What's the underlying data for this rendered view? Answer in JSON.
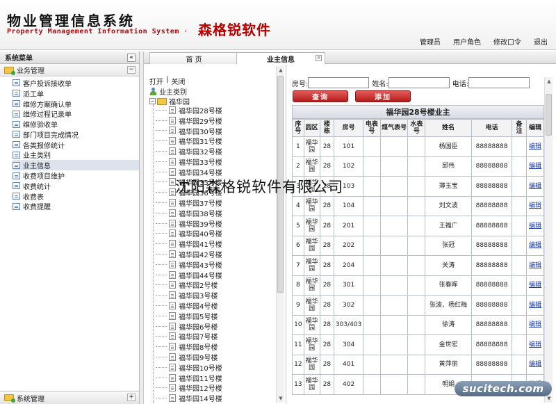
{
  "header": {
    "title_cn": "物业管理信息系统",
    "title_en": "Property  Management Information System ·",
    "company": "森格锐软件",
    "nav": [
      "管理员",
      "用户角色",
      "修改口令",
      "退出"
    ]
  },
  "sidebar": {
    "title": "系统菜单",
    "collapse": "«",
    "group": "业务管理",
    "group_toggle": "−",
    "items": [
      "客户投诉接收单",
      "派工单",
      "维修方案确认单",
      "维修过程记录单",
      "维修验收单",
      "部门项目完成情况",
      "各类报修统计",
      "业主类别",
      "业主信息",
      "收费项目维护",
      "收费统计",
      "收费表",
      "收费提醒"
    ],
    "active_item": "业主信息",
    "bottom_group": "系统管理",
    "bottom_toggle": "+"
  },
  "tabs": {
    "home": "首  页",
    "owner": "业主信息",
    "close": "×"
  },
  "tree": {
    "open": "打开",
    "sep": "|",
    "close": "关闭",
    "root": "业主类别",
    "park": "福华园",
    "expander": "−",
    "buildings": [
      "福华园28号楼",
      "福华园29号楼",
      "福华园30号楼",
      "福华园31号楼",
      "福华园32号楼",
      "福华园33号楼",
      "福华园34号楼",
      "福华园35号楼",
      "福华园36号楼",
      "福华园37号楼",
      "福华园38号楼",
      "福华园39号楼",
      "福华园40号楼",
      "福华园41号楼",
      "福华园42号楼",
      "福华园43号楼",
      "福华园44号楼",
      "福华园2号楼",
      "福华园3号楼",
      "福华园4号楼",
      "福华园5号楼",
      "福华园6号楼",
      "福华园7号楼",
      "福华园8号楼",
      "福华园9号楼",
      "福华园10号楼",
      "福华园11号楼",
      "福华园12号楼",
      "福华园14号楼"
    ]
  },
  "search": {
    "room_label": "房号:",
    "name_label": "姓名:",
    "phone_label": "电话:",
    "query_btn": "查询",
    "add_btn": "添加"
  },
  "grid": {
    "title": "福华园28号楼业主",
    "headers": [
      "序号",
      "园区",
      "楼栋",
      "房号",
      "电表号",
      "煤气表号",
      "水表号",
      "姓名",
      "电话",
      "备注",
      "编辑"
    ],
    "rows": [
      [
        "1",
        "福华园",
        "28",
        "101",
        "",
        "",
        "",
        "杨国臣",
        "88888888",
        "",
        "编辑"
      ],
      [
        "2",
        "福华园",
        "28",
        "102",
        "",
        "",
        "",
        "邱伟",
        "88888888",
        "",
        "编辑"
      ],
      [
        "3",
        "福华园",
        "28",
        "103",
        "",
        "",
        "",
        "薄玉宝",
        "88888888",
        "",
        "编辑"
      ],
      [
        "4",
        "福华园",
        "28",
        "104",
        "",
        "",
        "",
        "刘文波",
        "88888888",
        "",
        "编辑"
      ],
      [
        "5",
        "福华园",
        "28",
        "201",
        "",
        "",
        "",
        "王福广",
        "88888888",
        "",
        "编辑"
      ],
      [
        "6",
        "福华园",
        "28",
        "202",
        "",
        "",
        "",
        "张冠",
        "88888888",
        "",
        "编辑"
      ],
      [
        "7",
        "福华园",
        "28",
        "204",
        "",
        "",
        "",
        "关涛",
        "88888888",
        "",
        "编辑"
      ],
      [
        "8",
        "福华园",
        "28",
        "301",
        "",
        "",
        "",
        "张春晖",
        "88888888",
        "",
        "编辑"
      ],
      [
        "9",
        "福华园",
        "28",
        "302",
        "",
        "",
        "",
        "张波、杨红梅",
        "88888888",
        "",
        "编辑"
      ],
      [
        "10",
        "福华园",
        "28",
        "303/403",
        "",
        "",
        "",
        "徐涛",
        "88888888",
        "",
        "编辑"
      ],
      [
        "11",
        "福华园",
        "28",
        "304",
        "",
        "",
        "",
        "金世宏",
        "88888888",
        "",
        "编辑"
      ],
      [
        "12",
        "福华园",
        "28",
        "401",
        "",
        "",
        "",
        "黄萍丽",
        "88888888",
        "",
        "编辑"
      ],
      [
        "13",
        "福华园",
        "28",
        "402",
        "",
        "",
        "",
        "明娟",
        "88888888",
        "",
        "编辑"
      ]
    ]
  },
  "overlay": {
    "watermark": "沈阳森格锐软件有限公司",
    "badge": "sucitech.com"
  }
}
